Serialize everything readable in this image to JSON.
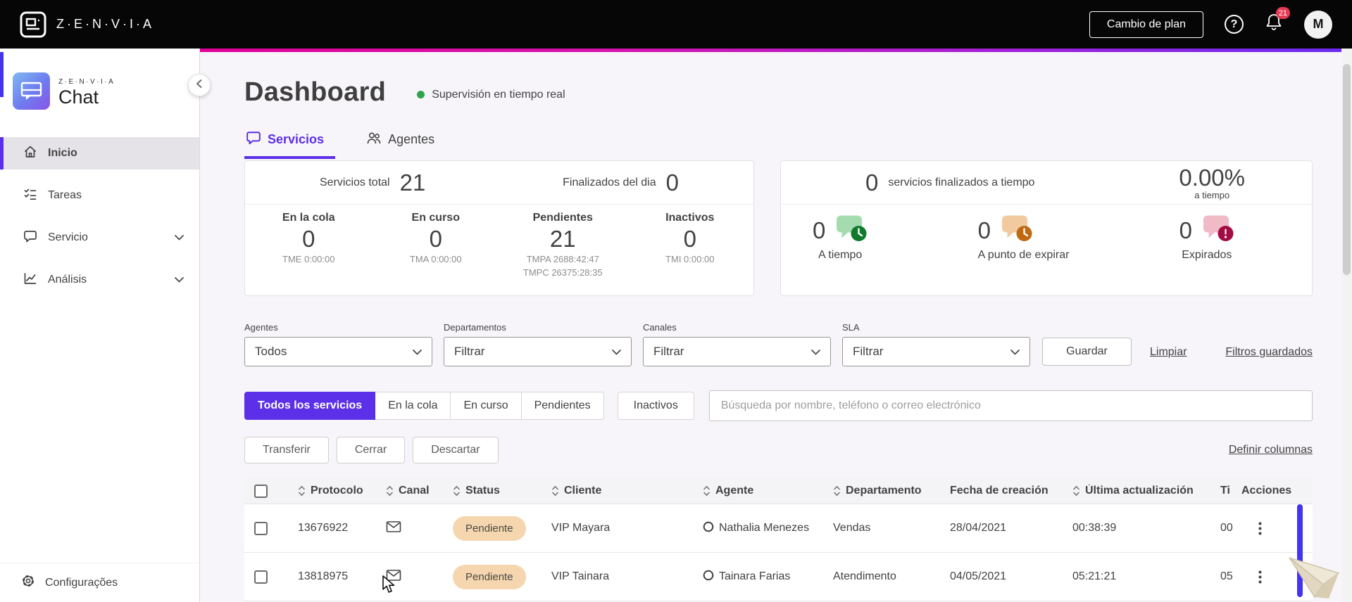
{
  "colors": {
    "accent_purple": "#5B30E8",
    "topbar_black": "#060606",
    "gradient_strip": [
      "#E10098",
      "#6A2CF5"
    ],
    "status_green": "#2EA44F",
    "pending_badge_bg": "#F5D6AE",
    "table_scrollbar_blue": "#4433F0",
    "notification_red": "#E83A55"
  },
  "topbar": {
    "brand": "Z·E·N·V·I·A",
    "change_plan_label": "Cambio de plan",
    "help_symbol": "?",
    "notification_count": "21",
    "avatar_initial": "M"
  },
  "sidebar": {
    "logo_brand": "Z·E·N·V·I·A",
    "logo_product": "Chat",
    "items": [
      {
        "label": "Inicio",
        "icon": "home-icon",
        "active": true
      },
      {
        "label": "Tareas",
        "icon": "tasks-icon",
        "active": false
      },
      {
        "label": "Servicio",
        "icon": "chat-bubble-icon",
        "active": false,
        "expandable": true
      },
      {
        "label": "Análisis",
        "icon": "chart-icon",
        "active": false,
        "expandable": true
      }
    ],
    "footer_label": "Configurações",
    "footer_icon": "gear-icon"
  },
  "header": {
    "title": "Dashboard",
    "status_text": "Supervisión en tiempo real"
  },
  "tabs": [
    {
      "label": "Servicios",
      "icon": "speech-bubble-icon",
      "active": true
    },
    {
      "label": "Agentes",
      "icon": "people-icon",
      "active": false
    }
  ],
  "stats": {
    "services_total_label": "Servicios total",
    "services_total_value": "21",
    "finished_today_label": "Finalizados del dia",
    "finished_today_value": "0",
    "columns": [
      {
        "label": "En la cola",
        "value": "0",
        "metric1": "TME 0:00:00"
      },
      {
        "label": "En curso",
        "value": "0",
        "metric1": "TMA 0:00:00"
      },
      {
        "label": "Pendientes",
        "value": "21",
        "metric1": "TMPA 2688:42:47",
        "metric2": "TMPC 26375:28:35"
      },
      {
        "label": "Inactivos",
        "value": "0",
        "metric1": "TMI 0:00:00"
      }
    ]
  },
  "sla": {
    "finished_value": "0",
    "finished_label": "servicios finalizados a tiempo",
    "percent_value": "0.00%",
    "percent_label": "a tiempo",
    "items": [
      {
        "value": "0",
        "label": "A tiempo",
        "icon": "chat-clock-green-icon"
      },
      {
        "value": "0",
        "label": "A punto de expirar",
        "icon": "chat-alarm-orange-icon"
      },
      {
        "value": "0",
        "label": "Expirados",
        "icon": "chat-alert-red-icon"
      }
    ]
  },
  "filters": {
    "fields": [
      {
        "label": "Agentes",
        "value": "Todos"
      },
      {
        "label": "Departamentos",
        "value": "Filtrar"
      },
      {
        "label": "Canales",
        "value": "Filtrar"
      },
      {
        "label": "SLA",
        "value": "Filtrar"
      }
    ],
    "save_label": "Guardar",
    "clear_label": "Limpiar",
    "saved_filters_label": "Filtros guardados"
  },
  "service_tabs": [
    {
      "label": "Todos los servicios",
      "active": true
    },
    {
      "label": "En la cola",
      "active": false
    },
    {
      "label": "En curso",
      "active": false
    },
    {
      "label": "Pendientes",
      "active": false
    },
    {
      "label": "Inactivos",
      "active": false
    }
  ],
  "search": {
    "placeholder": "Búsqueda por nombre, teléfono o correo electrónico"
  },
  "actions": {
    "transfer_label": "Transferir",
    "close_label": "Cerrar",
    "discard_label": "Descartar",
    "define_columns_label": "Definir columnas"
  },
  "table": {
    "columns": [
      {
        "label": "Protocolo",
        "sortable": true
      },
      {
        "label": "Canal",
        "sortable": true
      },
      {
        "label": "Status",
        "sortable": true
      },
      {
        "label": "Cliente",
        "sortable": true
      },
      {
        "label": "Agente",
        "sortable": true
      },
      {
        "label": "Departamento",
        "sortable": true
      },
      {
        "label": "Fecha de creación",
        "sortable": false
      },
      {
        "label": "Última actualización",
        "sortable": true
      },
      {
        "label": "Ti",
        "sortable": false
      },
      {
        "label": "Acciones",
        "sortable": false
      }
    ],
    "rows": [
      {
        "protocol": "13676922",
        "channel_icon": "envelope-icon",
        "status": "Pendiente",
        "client": "VIP Mayara",
        "agent": "Nathalia Menezes",
        "department": "Vendas",
        "created": "28/04/2021",
        "updated": "00:38:39",
        "time": "00"
      },
      {
        "protocol": "13818975",
        "channel_icon": "envelope-icon",
        "status": "Pendiente",
        "client": "VIP Tainara",
        "agent": "Tainara Farias",
        "department": "Atendimento",
        "created": "04/05/2021",
        "updated": "05:21:21",
        "time": "05"
      }
    ]
  }
}
